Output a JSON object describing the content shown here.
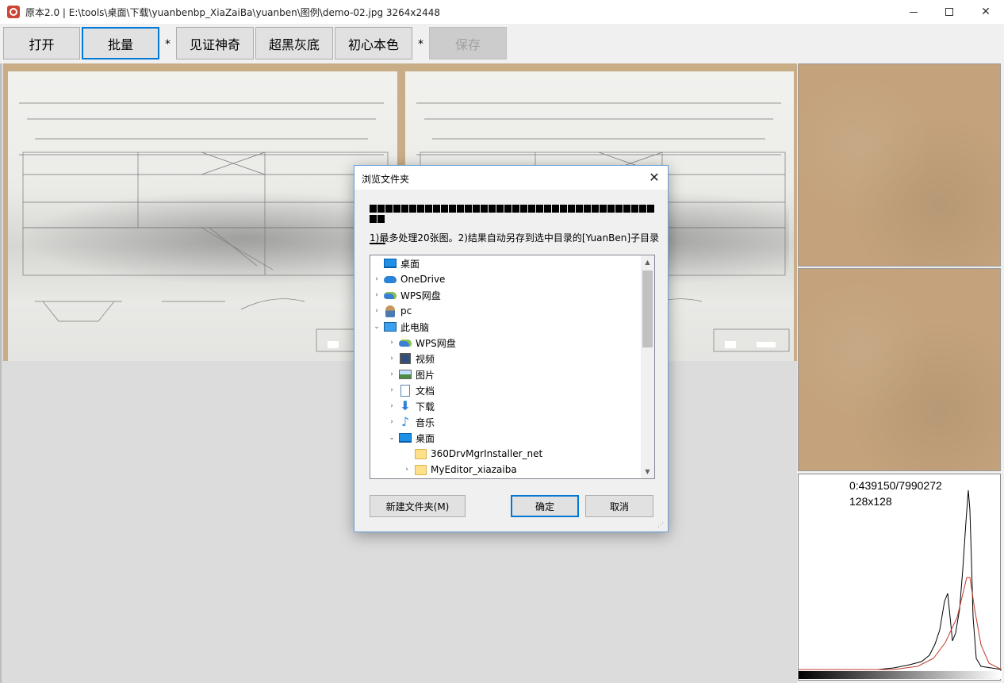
{
  "window": {
    "title": "原本2.0 | E:\\tools\\桌面\\下载\\yuanbenbp_XiaZaiBa\\yuanben\\图例\\demo-02.jpg 3264x2448"
  },
  "toolbar": {
    "open": "打开",
    "batch": "批量",
    "sep1": "*",
    "witness": "见证神奇",
    "ultra_black_gray": "超黑灰底",
    "original_color": "初心本色",
    "sep2": "*",
    "save": "保存"
  },
  "histogram": {
    "stats": "0:439150/7990272",
    "size": "128x128"
  },
  "dialog": {
    "title": "浏览文件夹",
    "description": "1)最多处理20张图。2)结果自动另存到选中目录的[YuanBen]子目录",
    "tree": [
      {
        "label": "桌面",
        "icon": "desktop-icon",
        "level": 0,
        "expander": ""
      },
      {
        "label": "OneDrive",
        "icon": "cloud-icon",
        "level": 0,
        "expander": "›"
      },
      {
        "label": "WPS网盘",
        "icon": "wps-cloud-icon",
        "level": 0,
        "expander": "›"
      },
      {
        "label": "pc",
        "icon": "user-icon",
        "level": 0,
        "expander": "›"
      },
      {
        "label": "此电脑",
        "icon": "computer-icon",
        "level": 0,
        "expander": "⌄"
      },
      {
        "label": "WPS网盘",
        "icon": "wps-cloud-icon",
        "level": 1,
        "expander": "›"
      },
      {
        "label": "视频",
        "icon": "video-icon",
        "level": 1,
        "expander": "›"
      },
      {
        "label": "图片",
        "icon": "picture-icon",
        "level": 1,
        "expander": "›"
      },
      {
        "label": "文档",
        "icon": "document-icon",
        "level": 1,
        "expander": "›"
      },
      {
        "label": "下载",
        "icon": "download-icon",
        "level": 1,
        "expander": "›"
      },
      {
        "label": "音乐",
        "icon": "music-icon",
        "level": 1,
        "expander": "›"
      },
      {
        "label": "桌面",
        "icon": "desktop-icon",
        "level": 1,
        "expander": "⌄"
      },
      {
        "label": "360DrvMgrInstaller_net",
        "icon": "folder-icon",
        "level": 2,
        "expander": ""
      },
      {
        "label": "MyEditor_xiazaiba",
        "icon": "folder-icon",
        "level": 2,
        "expander": "›"
      }
    ],
    "new_folder": "新建文件夹(M)",
    "ok": "确定",
    "cancel": "取消"
  },
  "colors": {
    "accent": "#0078d7",
    "photo_border": "#c8ad86",
    "texture": "#c3a27c",
    "hist_line_black": "#000000",
    "hist_line_red": "#c0392b"
  }
}
